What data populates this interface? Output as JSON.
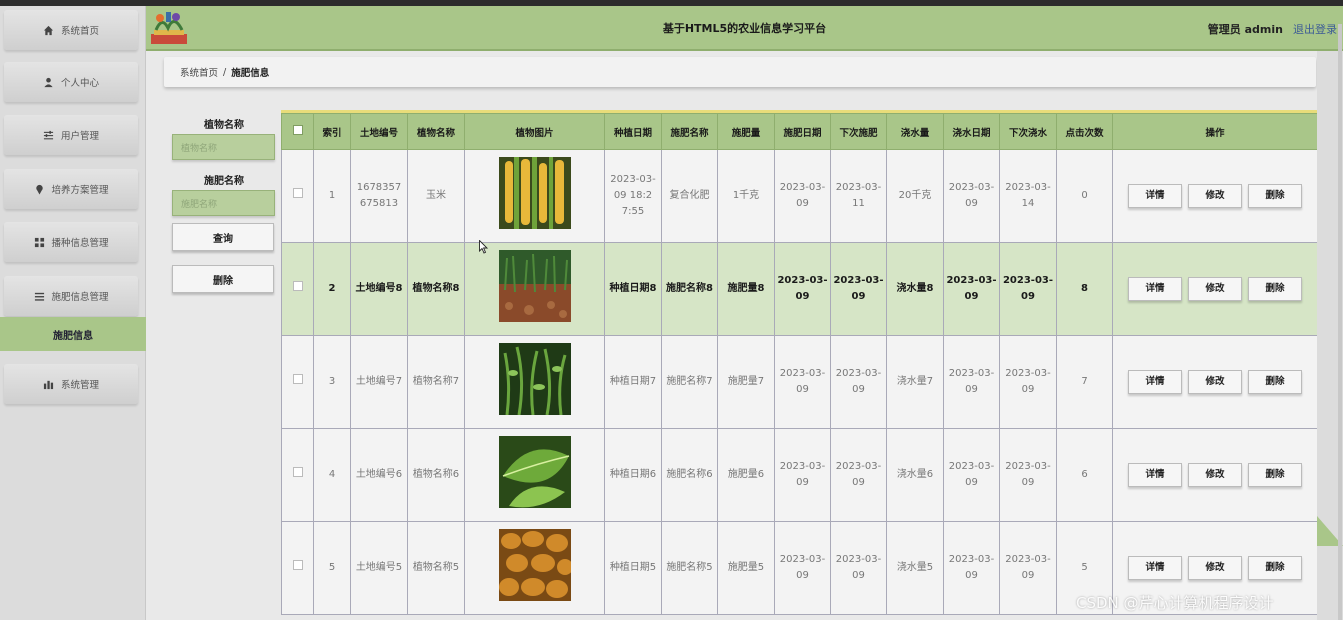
{
  "header": {
    "title": "基于HTML5的农业信息学习平台",
    "user": "管理员 admin",
    "logout": "退出登录"
  },
  "sidebar": {
    "items": [
      {
        "label": "系统首页",
        "icon": "home-icon"
      },
      {
        "label": "个人中心",
        "icon": "user-icon"
      },
      {
        "label": "用户管理",
        "icon": "sliders-icon"
      },
      {
        "label": "培养方案管理",
        "icon": "pin-icon"
      },
      {
        "label": "播种信息管理",
        "icon": "grid-icon"
      },
      {
        "label": "施肥信息管理",
        "icon": "list-icon"
      },
      {
        "label": "系统管理",
        "icon": "chart-icon"
      }
    ],
    "active_sub": "施肥信息"
  },
  "breadcrumb": {
    "home": "系统首页",
    "sep": "/",
    "current": "施肥信息"
  },
  "search": {
    "plant_label": "植物名称",
    "plant_placeholder": "植物名称",
    "fert_label": "施肥名称",
    "fert_placeholder": "施肥名称",
    "query_button": "查询",
    "delete_button": "删除"
  },
  "table": {
    "headers": [
      "索引",
      "土地编号",
      "植物名称",
      "植物图片",
      "种植日期",
      "施肥名称",
      "施肥量",
      "施肥日期",
      "下次施肥",
      "浇水量",
      "浇水日期",
      "下次浇水",
      "点击次数",
      "操作"
    ],
    "actions": {
      "detail": "详情",
      "edit": "修改",
      "delete": "删除"
    },
    "rows": [
      {
        "index": "1",
        "land": "1678357675813",
        "plant": "玉米",
        "image": "corn",
        "plant_date": "2023-03-09 18:27:55",
        "fert_name": "复合化肥",
        "fert_amount": "1千克",
        "fert_date": "2023-03-09",
        "next_fert": "2023-03-11",
        "water": "20千克",
        "water_date": "2023-03-09",
        "next_water": "2023-03-14",
        "clicks": "0",
        "highlight": false
      },
      {
        "index": "2",
        "land": "土地编号8",
        "plant": "植物名称8",
        "image": "seedlings",
        "plant_date": "种植日期8",
        "fert_name": "施肥名称8",
        "fert_amount": "施肥量8",
        "fert_date": "2023-03-09",
        "next_fert": "2023-03-09",
        "water": "浇水量8",
        "water_date": "2023-03-09",
        "next_water": "2023-03-09",
        "clicks": "8",
        "highlight": true
      },
      {
        "index": "3",
        "land": "土地编号7",
        "plant": "植物名称7",
        "image": "beans",
        "plant_date": "种植日期7",
        "fert_name": "施肥名称7",
        "fert_amount": "施肥量7",
        "fert_date": "2023-03-09",
        "next_fert": "2023-03-09",
        "water": "浇水量7",
        "water_date": "2023-03-09",
        "next_water": "2023-03-09",
        "clicks": "7",
        "highlight": false
      },
      {
        "index": "4",
        "land": "土地编号6",
        "plant": "植物名称6",
        "image": "leaves",
        "plant_date": "种植日期6",
        "fert_name": "施肥名称6",
        "fert_amount": "施肥量6",
        "fert_date": "2023-03-09",
        "next_fert": "2023-03-09",
        "water": "浇水量6",
        "water_date": "2023-03-09",
        "next_water": "2023-03-09",
        "clicks": "6",
        "highlight": false
      },
      {
        "index": "5",
        "land": "土地编号5",
        "plant": "植物名称5",
        "image": "potatoes",
        "plant_date": "种植日期5",
        "fert_name": "施肥名称5",
        "fert_amount": "施肥量5",
        "fert_date": "2023-03-09",
        "next_fert": "2023-03-09",
        "water": "浇水量5",
        "water_date": "2023-03-09",
        "next_water": "2023-03-09",
        "clicks": "5",
        "highlight": false
      }
    ]
  },
  "watermark": "CSDN @芹心计算机程序设计",
  "colors": {
    "accent": "#a9c689",
    "highlight_row": "#d6e5c6",
    "header_border": "#e8dc7a"
  }
}
